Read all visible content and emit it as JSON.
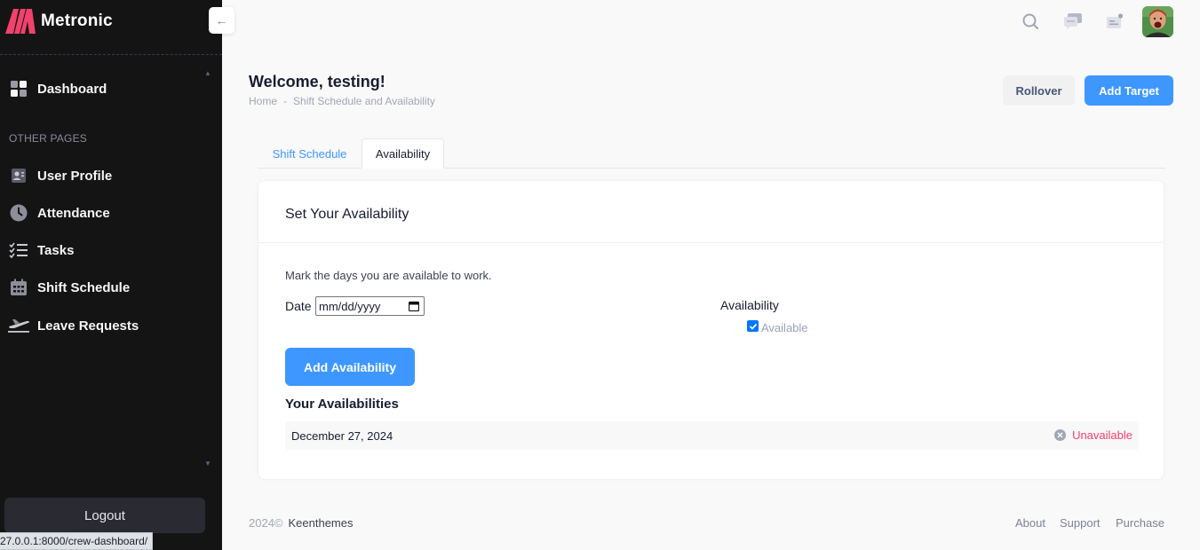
{
  "app": {
    "brand": "Metronic",
    "colors": {
      "sidebar_bg": "#141414",
      "accent": "#3e97ff",
      "danger": "#f1416c",
      "logo": "#f1416c"
    }
  },
  "sidebar": {
    "dashboard": {
      "label": "Dashboard",
      "icon": "dashboard-grid-icon"
    },
    "section_title": "OTHER PAGES",
    "items": [
      {
        "label": "User Profile",
        "icon": "user-profile-icon"
      },
      {
        "label": "Attendance",
        "icon": "clock-icon"
      },
      {
        "label": "Tasks",
        "icon": "checklist-icon"
      },
      {
        "label": "Shift Schedule",
        "icon": "calendar-icon"
      },
      {
        "label": "Leave Requests",
        "icon": "airplane-icon"
      }
    ],
    "logout_label": "Logout"
  },
  "status_bar": {
    "url": "27.0.0.1:8000/crew-dashboard/"
  },
  "header": {
    "icons": [
      "search-icon",
      "chat-icon",
      "notification-icon",
      "user-avatar"
    ]
  },
  "page": {
    "title": "Welcome, testing!",
    "breadcrumb": {
      "home": "Home",
      "separator": "-",
      "current": "Shift Schedule and Availability"
    },
    "rollover_label": "Rollover",
    "add_target_label": "Add Target"
  },
  "tabs": [
    {
      "label": "Shift Schedule",
      "active": false
    },
    {
      "label": "Availability",
      "active": true
    }
  ],
  "card": {
    "title": "Set Your Availability",
    "description": "Mark the days you are available to work.",
    "date_label": "Date",
    "date_placeholder": "mm/dd/yyyy",
    "availability_label": "Availability",
    "checkbox_label": "Available",
    "checkbox_checked": true,
    "add_button": "Add Availability",
    "list_heading": "Your Availabilities",
    "entries": [
      {
        "date": "December 27, 2024",
        "status": "Unavailable"
      }
    ]
  },
  "footer": {
    "year": "2024©",
    "brand": "Keenthemes",
    "links": [
      "About",
      "Support",
      "Purchase"
    ]
  }
}
